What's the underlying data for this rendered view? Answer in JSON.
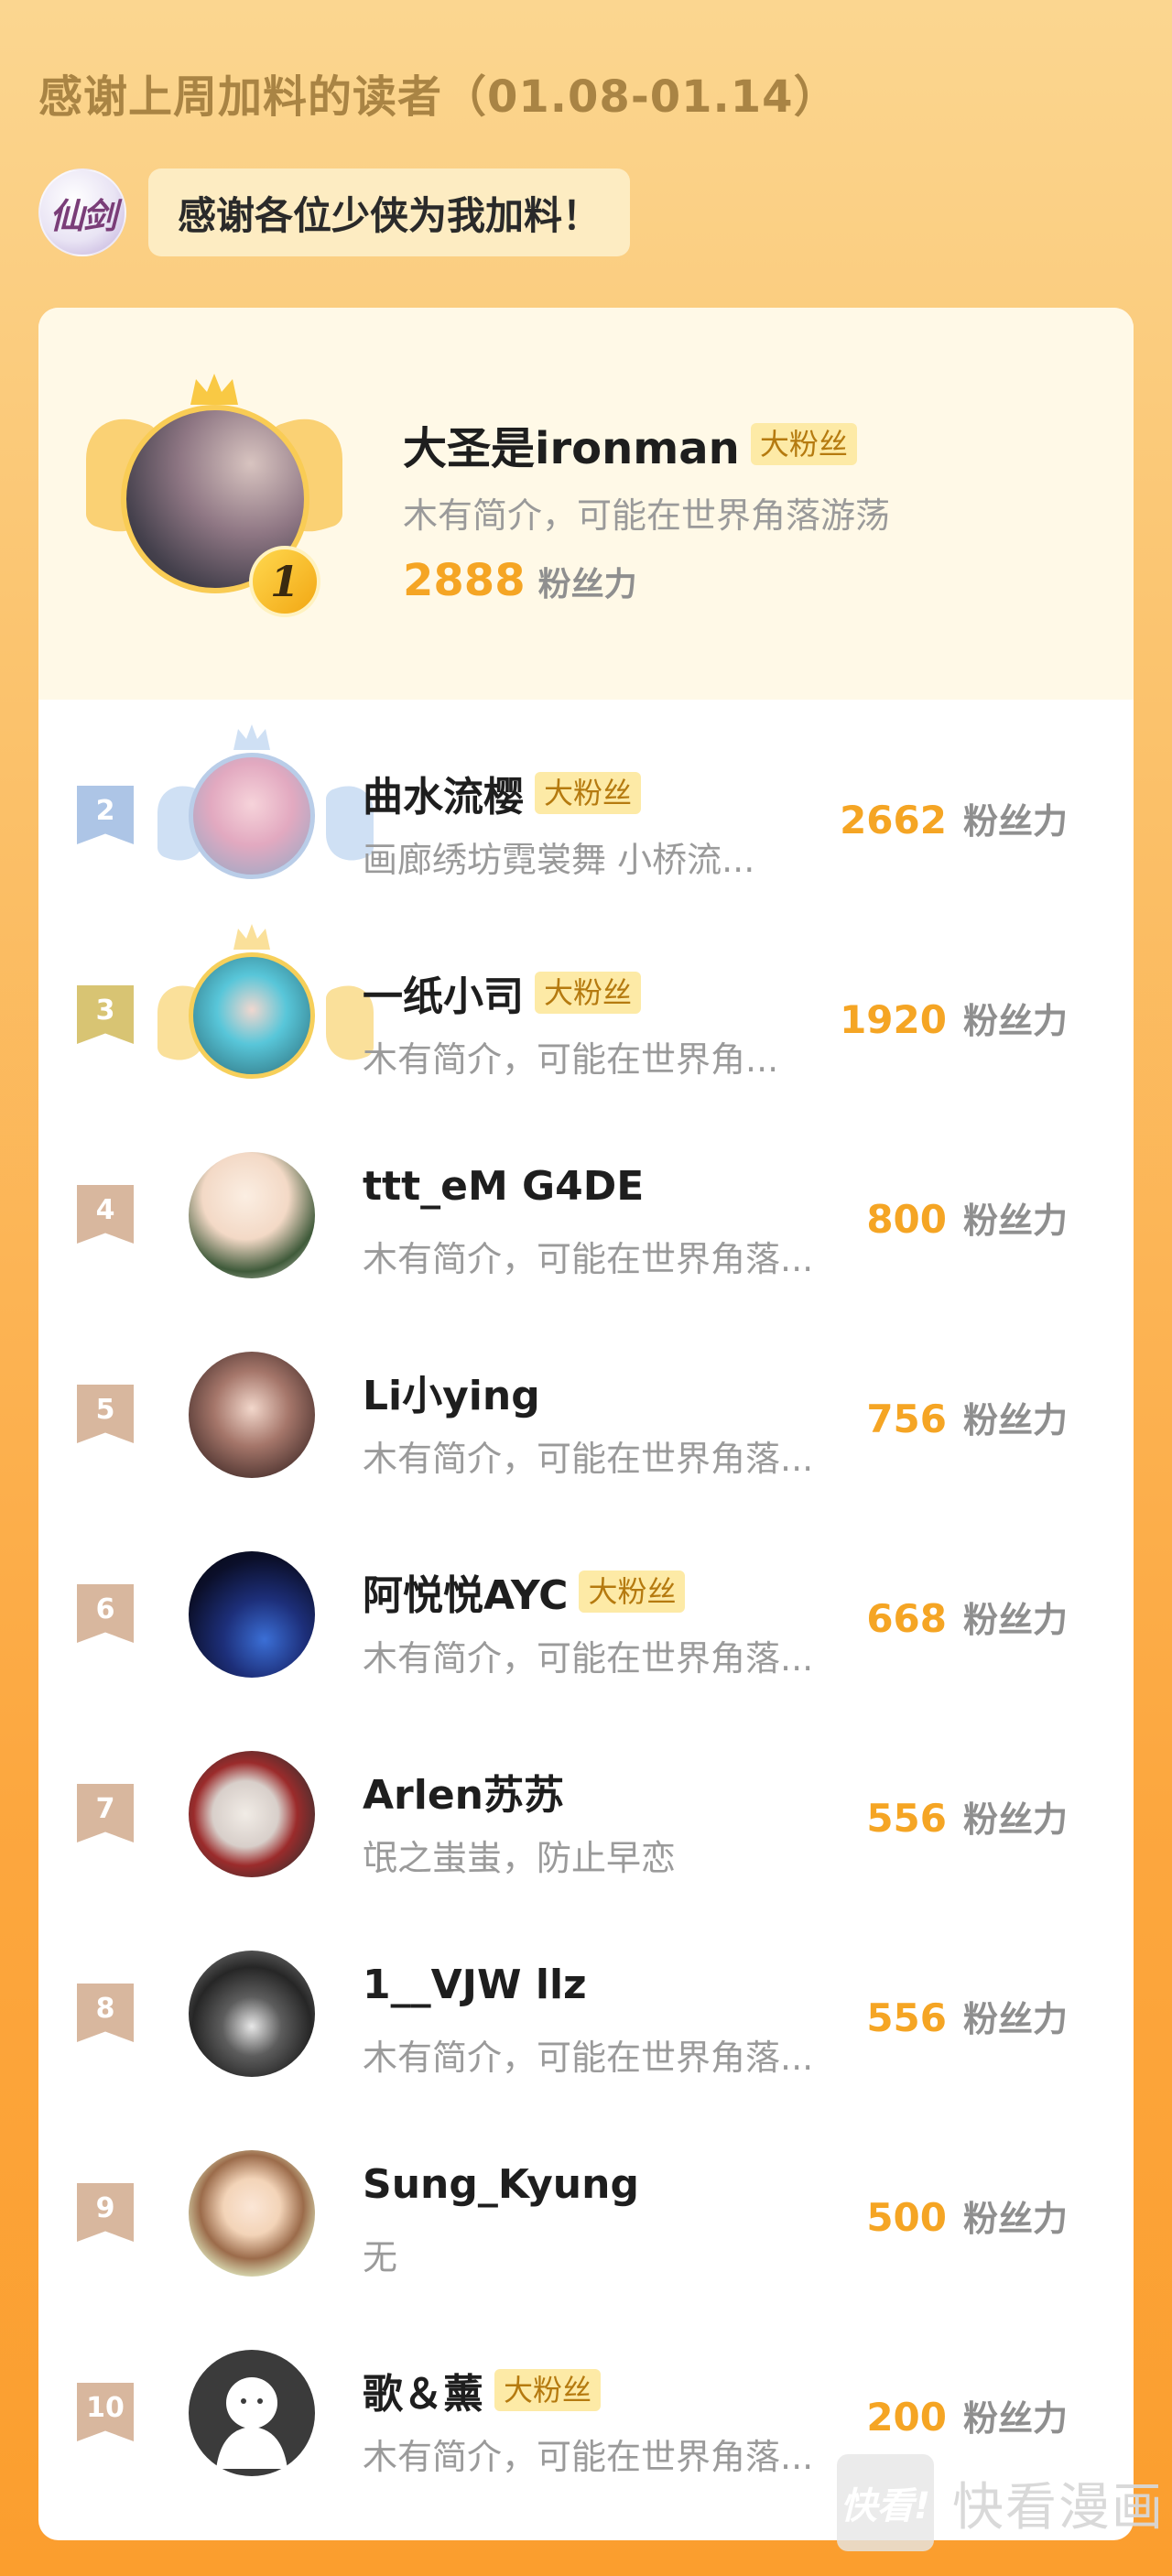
{
  "header": {
    "title": "感谢上周加料的读者（01.08-01.14）",
    "logo_text": "仙剑",
    "thanks": "感谢各位少侠为我加料！"
  },
  "colors": {
    "accent": "#f5a524",
    "tag_bg": "#fdeaa6",
    "tag_text": "#b57a0f",
    "rank2": "#adc5e6",
    "rank3": "#d8c473",
    "rank_other": "#d8b79e"
  },
  "top_reader": {
    "rank": "1",
    "name": "大圣是ironman",
    "tag": "大粉丝",
    "bio": "木有简介，可能在世界角落游荡",
    "score": "2888",
    "unit": "粉丝力"
  },
  "readers": [
    {
      "rank": "2",
      "name": "曲水流樱",
      "tag": "大粉丝",
      "bio": "画廊绣坊霓裳舞 小桥流...",
      "score": "2662",
      "unit": "粉丝力"
    },
    {
      "rank": "3",
      "name": "一纸小司",
      "tag": "大粉丝",
      "bio": "木有简介，可能在世界角...",
      "score": "1920",
      "unit": "粉丝力"
    },
    {
      "rank": "4",
      "name": "ttt_eM G4DE",
      "tag": "",
      "bio": "木有简介，可能在世界角落...",
      "score": "800",
      "unit": "粉丝力"
    },
    {
      "rank": "5",
      "name": "Li小ying",
      "tag": "",
      "bio": "木有简介，可能在世界角落...",
      "score": "756",
      "unit": "粉丝力"
    },
    {
      "rank": "6",
      "name": "阿悦悦AYC",
      "tag": "大粉丝",
      "bio": "木有简介，可能在世界角落...",
      "score": "668",
      "unit": "粉丝力"
    },
    {
      "rank": "7",
      "name": "Arlen苏苏",
      "tag": "",
      "bio": "氓之蚩蚩，防止早恋",
      "score": "556",
      "unit": "粉丝力"
    },
    {
      "rank": "8",
      "name": "1__VJW llz",
      "tag": "",
      "bio": "木有简介，可能在世界角落...",
      "score": "556",
      "unit": "粉丝力"
    },
    {
      "rank": "9",
      "name": "Sung_Kyung",
      "tag": "",
      "bio": "无",
      "score": "500",
      "unit": "粉丝力"
    },
    {
      "rank": "10",
      "name": "歌＆薰",
      "tag": "大粉丝",
      "bio": "木有简介，可能在世界角落...",
      "score": "200",
      "unit": "粉丝力"
    }
  ],
  "watermark": {
    "logo": "快看!",
    "text": "快看漫画"
  }
}
